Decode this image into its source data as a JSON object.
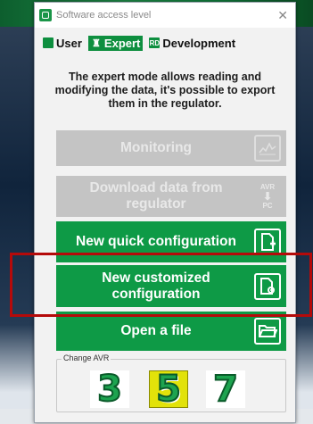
{
  "window": {
    "title": "Software access level",
    "close_glyph": "✕"
  },
  "levels": [
    {
      "label": "User",
      "icon": "user-icon",
      "glyph": "▪",
      "active": false
    },
    {
      "label": "Expert",
      "icon": "expert-icon",
      "glyph": "♜",
      "active": true
    },
    {
      "label": "Development",
      "icon": "development-icon",
      "glyph": "RD",
      "active": false
    }
  ],
  "description": "The expert mode allows reading and modifying the data, it's possible to export them in the regulator.",
  "buttons": {
    "monitoring": {
      "label": "Monitoring",
      "enabled": false,
      "icon": "monitor-chart-icon"
    },
    "download": {
      "label": "Download data from regulator",
      "enabled": false,
      "icon": "avr-to-pc-icon",
      "icon_top": "AVR",
      "icon_bottom": "PC"
    },
    "new_quick": {
      "label": "New quick configuration",
      "enabled": true,
      "icon": "new-file-icon"
    },
    "new_custom": {
      "label": "New customized configuration",
      "enabled": true,
      "icon": "settings-file-icon"
    },
    "open_file": {
      "label": "Open a file",
      "enabled": true,
      "icon": "open-folder-icon"
    }
  },
  "avr": {
    "legend": "Change AVR",
    "options": [
      {
        "label": "3",
        "selected": false
      },
      {
        "label": "5",
        "selected": true
      },
      {
        "label": "7",
        "selected": false
      }
    ]
  },
  "colors": {
    "accent_green": "#0e9a46",
    "disabled_gray": "#c4c4c4",
    "highlight_red": "#b50a0a",
    "selected_yellow": "#e2e20a"
  }
}
